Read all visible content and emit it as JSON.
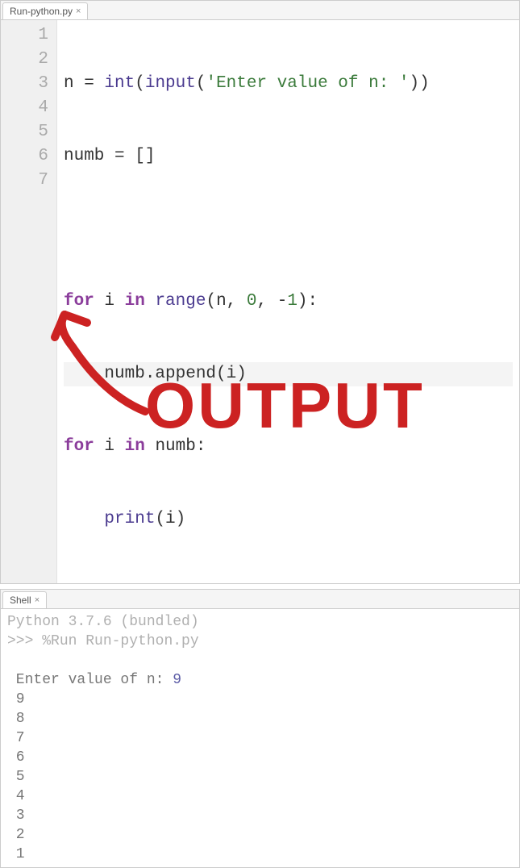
{
  "editor": {
    "tab": {
      "label": "Run-python.py"
    },
    "lineNumbers": [
      "1",
      "2",
      "3",
      "4",
      "5",
      "6",
      "7"
    ],
    "code": {
      "line1": {
        "a": "n = ",
        "b": "int",
        "c": "(",
        "d": "input",
        "e": "(",
        "f": "'Enter value of n: '",
        "g": "))"
      },
      "line2": {
        "a": "numb = []"
      },
      "line4": {
        "a": "for",
        "b": " i ",
        "c": "in",
        "d": " ",
        "e": "range",
        "f": "(n, ",
        "g": "0",
        "h": ", -",
        "i": "1",
        "j": "):"
      },
      "line5": {
        "a": "    numb.append(i)"
      },
      "line6": {
        "a": "for",
        "b": " i ",
        "c": "in",
        "d": " numb:"
      },
      "line7": {
        "a": "    ",
        "b": "print",
        "c": "(i)"
      }
    }
  },
  "shell": {
    "tab": {
      "label": "Shell"
    },
    "version": "Python 3.7.6 (bundled)",
    "prompt": ">>> ",
    "runCmd": "%Run Run-python.py",
    "inputPrompt": " Enter value of n: ",
    "inputValue": "9",
    "outputLines": [
      " 9",
      " 8",
      " 7",
      " 6",
      " 5",
      " 4",
      " 3",
      " 2",
      " 1"
    ]
  },
  "annotation": {
    "label": "OUTPUT"
  }
}
